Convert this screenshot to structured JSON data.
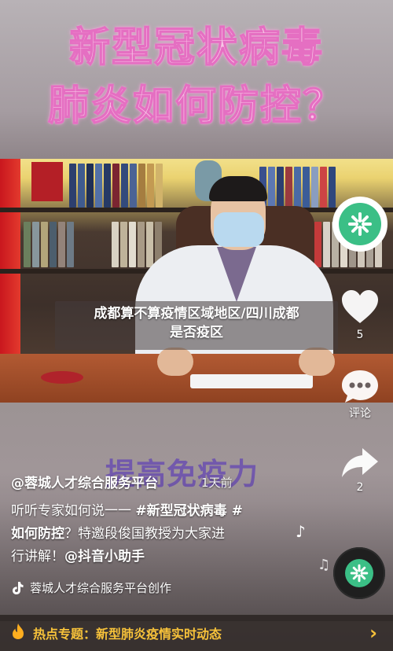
{
  "banner": {
    "line1": "新型冠状病毒",
    "line2": "肺炎如何防控？"
  },
  "caption": {
    "line1": "成都算不算疫情区域地区/四川成都",
    "line2": "是否疫区"
  },
  "video_overlay_text": "提高免疫力",
  "rail": {
    "like_count": "5",
    "comment_label": "评论",
    "share_count": "2"
  },
  "post": {
    "author": "@蓉城人才综合服务平台",
    "time": "1天前",
    "desc_line1_plain": "听听专家如何说一一 ",
    "desc_line1_tag": "#新型冠状病毒 #",
    "desc_line2_tag": "如何防控",
    "desc_line2_plain": "？特邀段俊国教授为大家进",
    "desc_line3_plain": "行讲解！",
    "desc_line3_mention": "@抖音小助手",
    "music": "蓉城人才综合服务平台创作"
  },
  "hot_topic": {
    "label": "热点专题：新型肺炎疫情实时动态"
  },
  "colors": {
    "banner_text": "#f7c6e6",
    "banner_stroke": "#e56fc2",
    "hot_text": "#f7c23a",
    "brand_green": "#3bbf86"
  }
}
